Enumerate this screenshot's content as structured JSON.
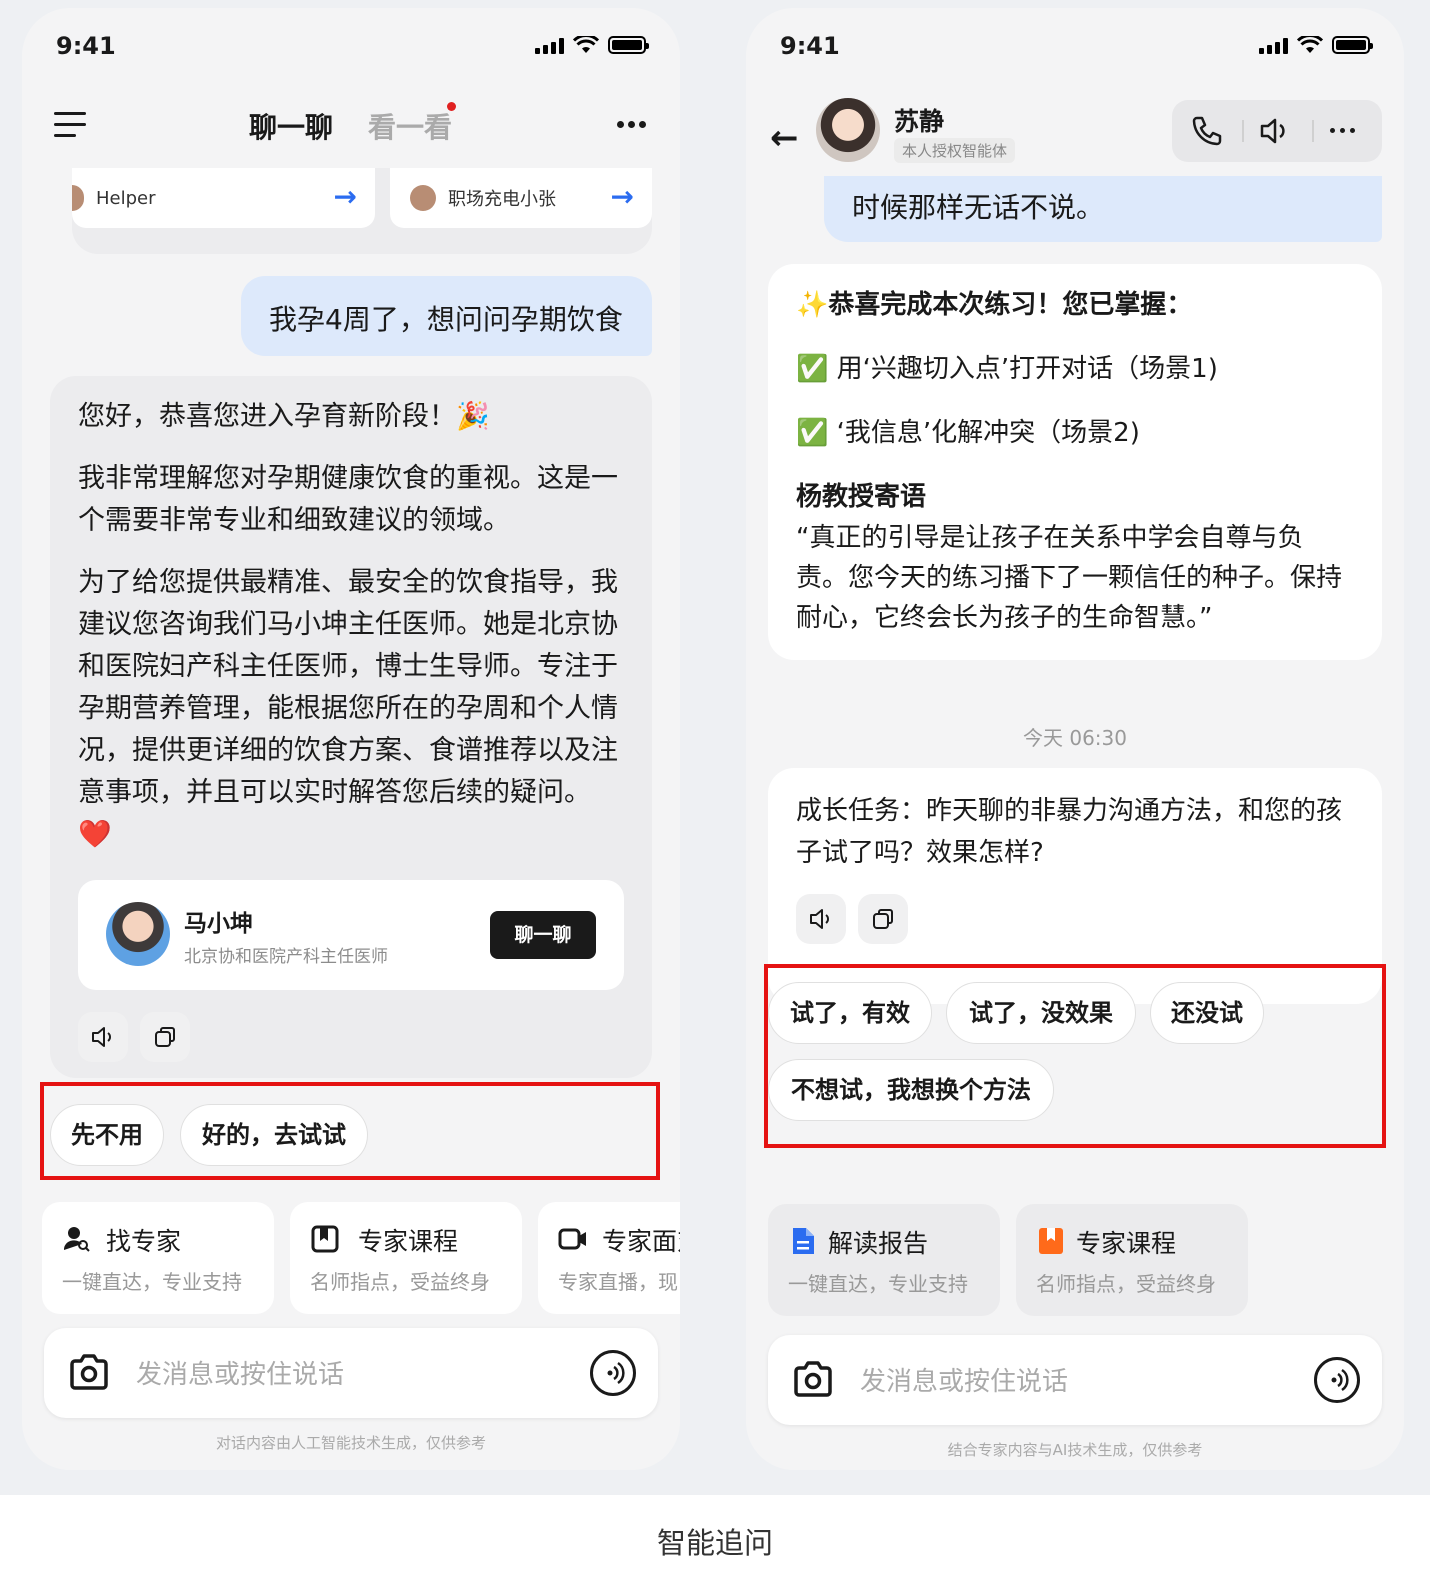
{
  "caption": "智能追问",
  "left": {
    "status_time": "9:41",
    "tabs": {
      "chat": "聊一聊",
      "look": "看一看"
    },
    "helpers": [
      {
        "label": "Helper"
      },
      {
        "label": "职场充电小张"
      }
    ],
    "user_message": "我孕4周了，想问问孕期饮食",
    "ai_paragraphs": [
      "您好，恭喜您进入孕育新阶段！🎉",
      "我非常理解您对孕期健康饮食的重视。这是一个需要非常专业和细致建议的领域。",
      "为了给您提供最精准、最安全的饮食指导，我建议您咨询我们马小坤主任医师。她是北京协和医院妇产科主任医师，博士生导师。专注于孕期营养管理，能根据您所在的孕周和个人情况，提供更详细的饮食方案、食谱推荐以及注意事项，并且可以实时解答您后续的疑问。❤️"
    ],
    "expert": {
      "name": "马小坤",
      "title": "北京协和医院产科主任医师",
      "button": "聊一聊"
    },
    "chips": [
      "先不用",
      "好的，去试试"
    ],
    "tools": [
      {
        "title": "找专家",
        "subtitle": "一键直达，专业支持",
        "icon": "person-search-icon"
      },
      {
        "title": "专家课程",
        "subtitle": "名师指点，受益终身",
        "icon": "book-icon"
      },
      {
        "title": "专家面对",
        "subtitle": "专家直播，现",
        "icon": "video-icon"
      }
    ],
    "input_placeholder": "发消息或按住说话",
    "disclaimer": "对话内容由人工智能技术生成，仅供参考"
  },
  "right": {
    "status_time": "9:41",
    "contact": {
      "name": "苏静",
      "badge": "本人授权智能体"
    },
    "user_message_tail": "时候那样无话不说。",
    "summary": {
      "heading": "✨恭喜完成本次练习！您已掌握：",
      "items": [
        "✅ 用‘兴趣切入点’打开对话（场景1)",
        "✅ ‘我信息’化解冲突（场景2)"
      ],
      "quote_title": "杨教授寄语",
      "quote": "“真正的引导是让孩子在关系中学会自尊与负责。您今天的练习播下了一颗信任的种子。保持耐心，它终会长为孩子的生命智慧。”"
    },
    "timestamp": "今天 06:30",
    "ai_message": "成长任务：昨天聊的非暴力沟通方法，和您的孩子试了吗？效果怎样?",
    "chips": [
      "试了，有效",
      "试了，没效果",
      "还没试",
      "不想试，我想换个方法"
    ],
    "tools": [
      {
        "title": "解读报告",
        "subtitle": "一键直达，专业支持",
        "icon": "document-icon",
        "color": "#2b6cf0"
      },
      {
        "title": "专家课程",
        "subtitle": "名师指点，受益终身",
        "icon": "bookmark-icon",
        "color": "#ff6a1a"
      }
    ],
    "input_placeholder": "发消息或按住说话",
    "disclaimer": "结合专家内容与AI技术生成，仅供参考"
  },
  "colors": {
    "accent_blue": "#2b6cf0",
    "highlight_red": "#e51212",
    "user_bubble": "#dde9fb"
  }
}
